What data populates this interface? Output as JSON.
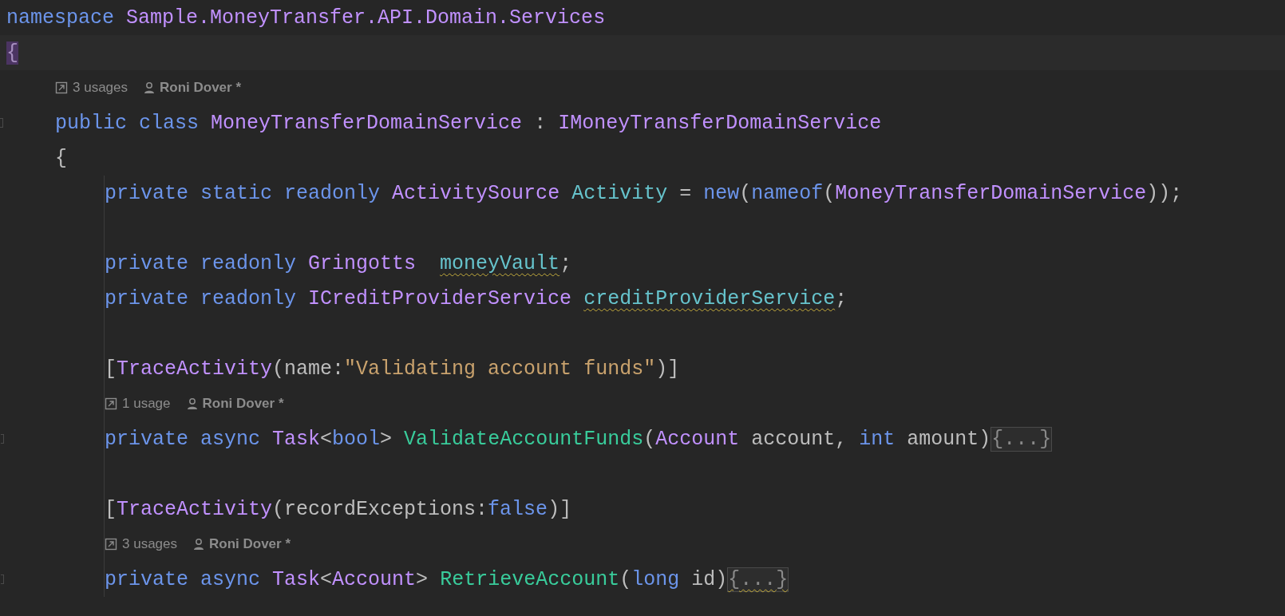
{
  "lines": [
    {
      "kind": "code",
      "tokens": [
        {
          "text": "namespace ",
          "kind": "keyword"
        },
        {
          "text": "Sample.MoneyTransfer.API.Domain.Services",
          "kind": "type"
        }
      ]
    },
    {
      "kind": "code",
      "current": true,
      "tokens": [
        {
          "text": "{",
          "kind": "brace_match"
        }
      ],
      "children": [
        {
          "kind": "hint",
          "usages": "3 usages",
          "author": "Roni Dover *"
        },
        {
          "kind": "code",
          "fold_mark": true,
          "tokens": [
            {
              "text": "public ",
              "kind": "keyword"
            },
            {
              "text": "class ",
              "kind": "keyword"
            },
            {
              "text": "MoneyTransferDomainService",
              "kind": "type"
            },
            {
              "text": " : "
            },
            {
              "text": "IMoneyTransferDomainService",
              "kind": "type"
            }
          ]
        },
        {
          "kind": "code",
          "tokens": [
            {
              "text": "{"
            }
          ],
          "children": [
            {
              "kind": "code",
              "tokens": [
                {
                  "text": "private ",
                  "kind": "keyword"
                },
                {
                  "text": "static ",
                  "kind": "keyword"
                },
                {
                  "text": "readonly ",
                  "kind": "keyword"
                },
                {
                  "text": "ActivitySource ",
                  "kind": "type"
                },
                {
                  "text": "Activity",
                  "kind": "field"
                },
                {
                  "text": " = "
                },
                {
                  "text": "new",
                  "kind": "keyword"
                },
                {
                  "text": "("
                },
                {
                  "text": "nameof",
                  "kind": "keyword"
                },
                {
                  "text": "("
                },
                {
                  "text": "MoneyTransferDomainService",
                  "kind": "type"
                },
                {
                  "text": "));"
                }
              ]
            },
            {
              "kind": "blank"
            },
            {
              "kind": "code",
              "tokens": [
                {
                  "text": "private ",
                  "kind": "keyword"
                },
                {
                  "text": "readonly ",
                  "kind": "keyword"
                },
                {
                  "text": "Gringotts  ",
                  "kind": "type"
                },
                {
                  "text": "moneyVault",
                  "kind": "field",
                  "squiggle": true
                },
                {
                  "text": ";"
                }
              ]
            },
            {
              "kind": "code",
              "tokens": [
                {
                  "text": "private ",
                  "kind": "keyword"
                },
                {
                  "text": "readonly ",
                  "kind": "keyword"
                },
                {
                  "text": "ICreditProviderService ",
                  "kind": "type"
                },
                {
                  "text": "creditProviderService",
                  "kind": "field",
                  "squiggle": true
                },
                {
                  "text": ";"
                }
              ]
            },
            {
              "kind": "blank"
            },
            {
              "kind": "code",
              "tokens": [
                {
                  "text": "["
                },
                {
                  "text": "TraceActivity",
                  "kind": "type"
                },
                {
                  "text": "(name:"
                },
                {
                  "text": "\"Validating account funds\"",
                  "kind": "string"
                },
                {
                  "text": ")]"
                }
              ]
            },
            {
              "kind": "hint",
              "usages": "1 usage",
              "author": "Roni Dover *"
            },
            {
              "kind": "code",
              "fold_mark": true,
              "tokens": [
                {
                  "text": "private ",
                  "kind": "keyword"
                },
                {
                  "text": "async ",
                  "kind": "keyword"
                },
                {
                  "text": "Task",
                  "kind": "type"
                },
                {
                  "text": "<"
                },
                {
                  "text": "bool",
                  "kind": "keyword"
                },
                {
                  "text": "> "
                },
                {
                  "text": "ValidateAccountFunds",
                  "kind": "method"
                },
                {
                  "text": "("
                },
                {
                  "text": "Account",
                  "kind": "type"
                },
                {
                  "text": " account, "
                },
                {
                  "text": "int",
                  "kind": "keyword"
                },
                {
                  "text": " amount)"
                },
                {
                  "text": "{...}",
                  "kind": "fold"
                }
              ]
            },
            {
              "kind": "blank"
            },
            {
              "kind": "code",
              "tokens": [
                {
                  "text": "["
                },
                {
                  "text": "TraceActivity",
                  "kind": "type"
                },
                {
                  "text": "(recordExceptions:"
                },
                {
                  "text": "false",
                  "kind": "keyword"
                },
                {
                  "text": ")]"
                }
              ]
            },
            {
              "kind": "hint",
              "usages": "3 usages",
              "author": "Roni Dover *"
            },
            {
              "kind": "code",
              "fold_mark": true,
              "tokens": [
                {
                  "text": "private ",
                  "kind": "keyword"
                },
                {
                  "text": "async ",
                  "kind": "keyword"
                },
                {
                  "text": "Task",
                  "kind": "type"
                },
                {
                  "text": "<"
                },
                {
                  "text": "Account",
                  "kind": "type"
                },
                {
                  "text": "> "
                },
                {
                  "text": "RetrieveAccount",
                  "kind": "method"
                },
                {
                  "text": "("
                },
                {
                  "text": "long",
                  "kind": "keyword"
                },
                {
                  "text": " id)"
                },
                {
                  "text": "{...}",
                  "kind": "fold",
                  "squiggle": true
                }
              ]
            }
          ]
        }
      ]
    }
  ]
}
